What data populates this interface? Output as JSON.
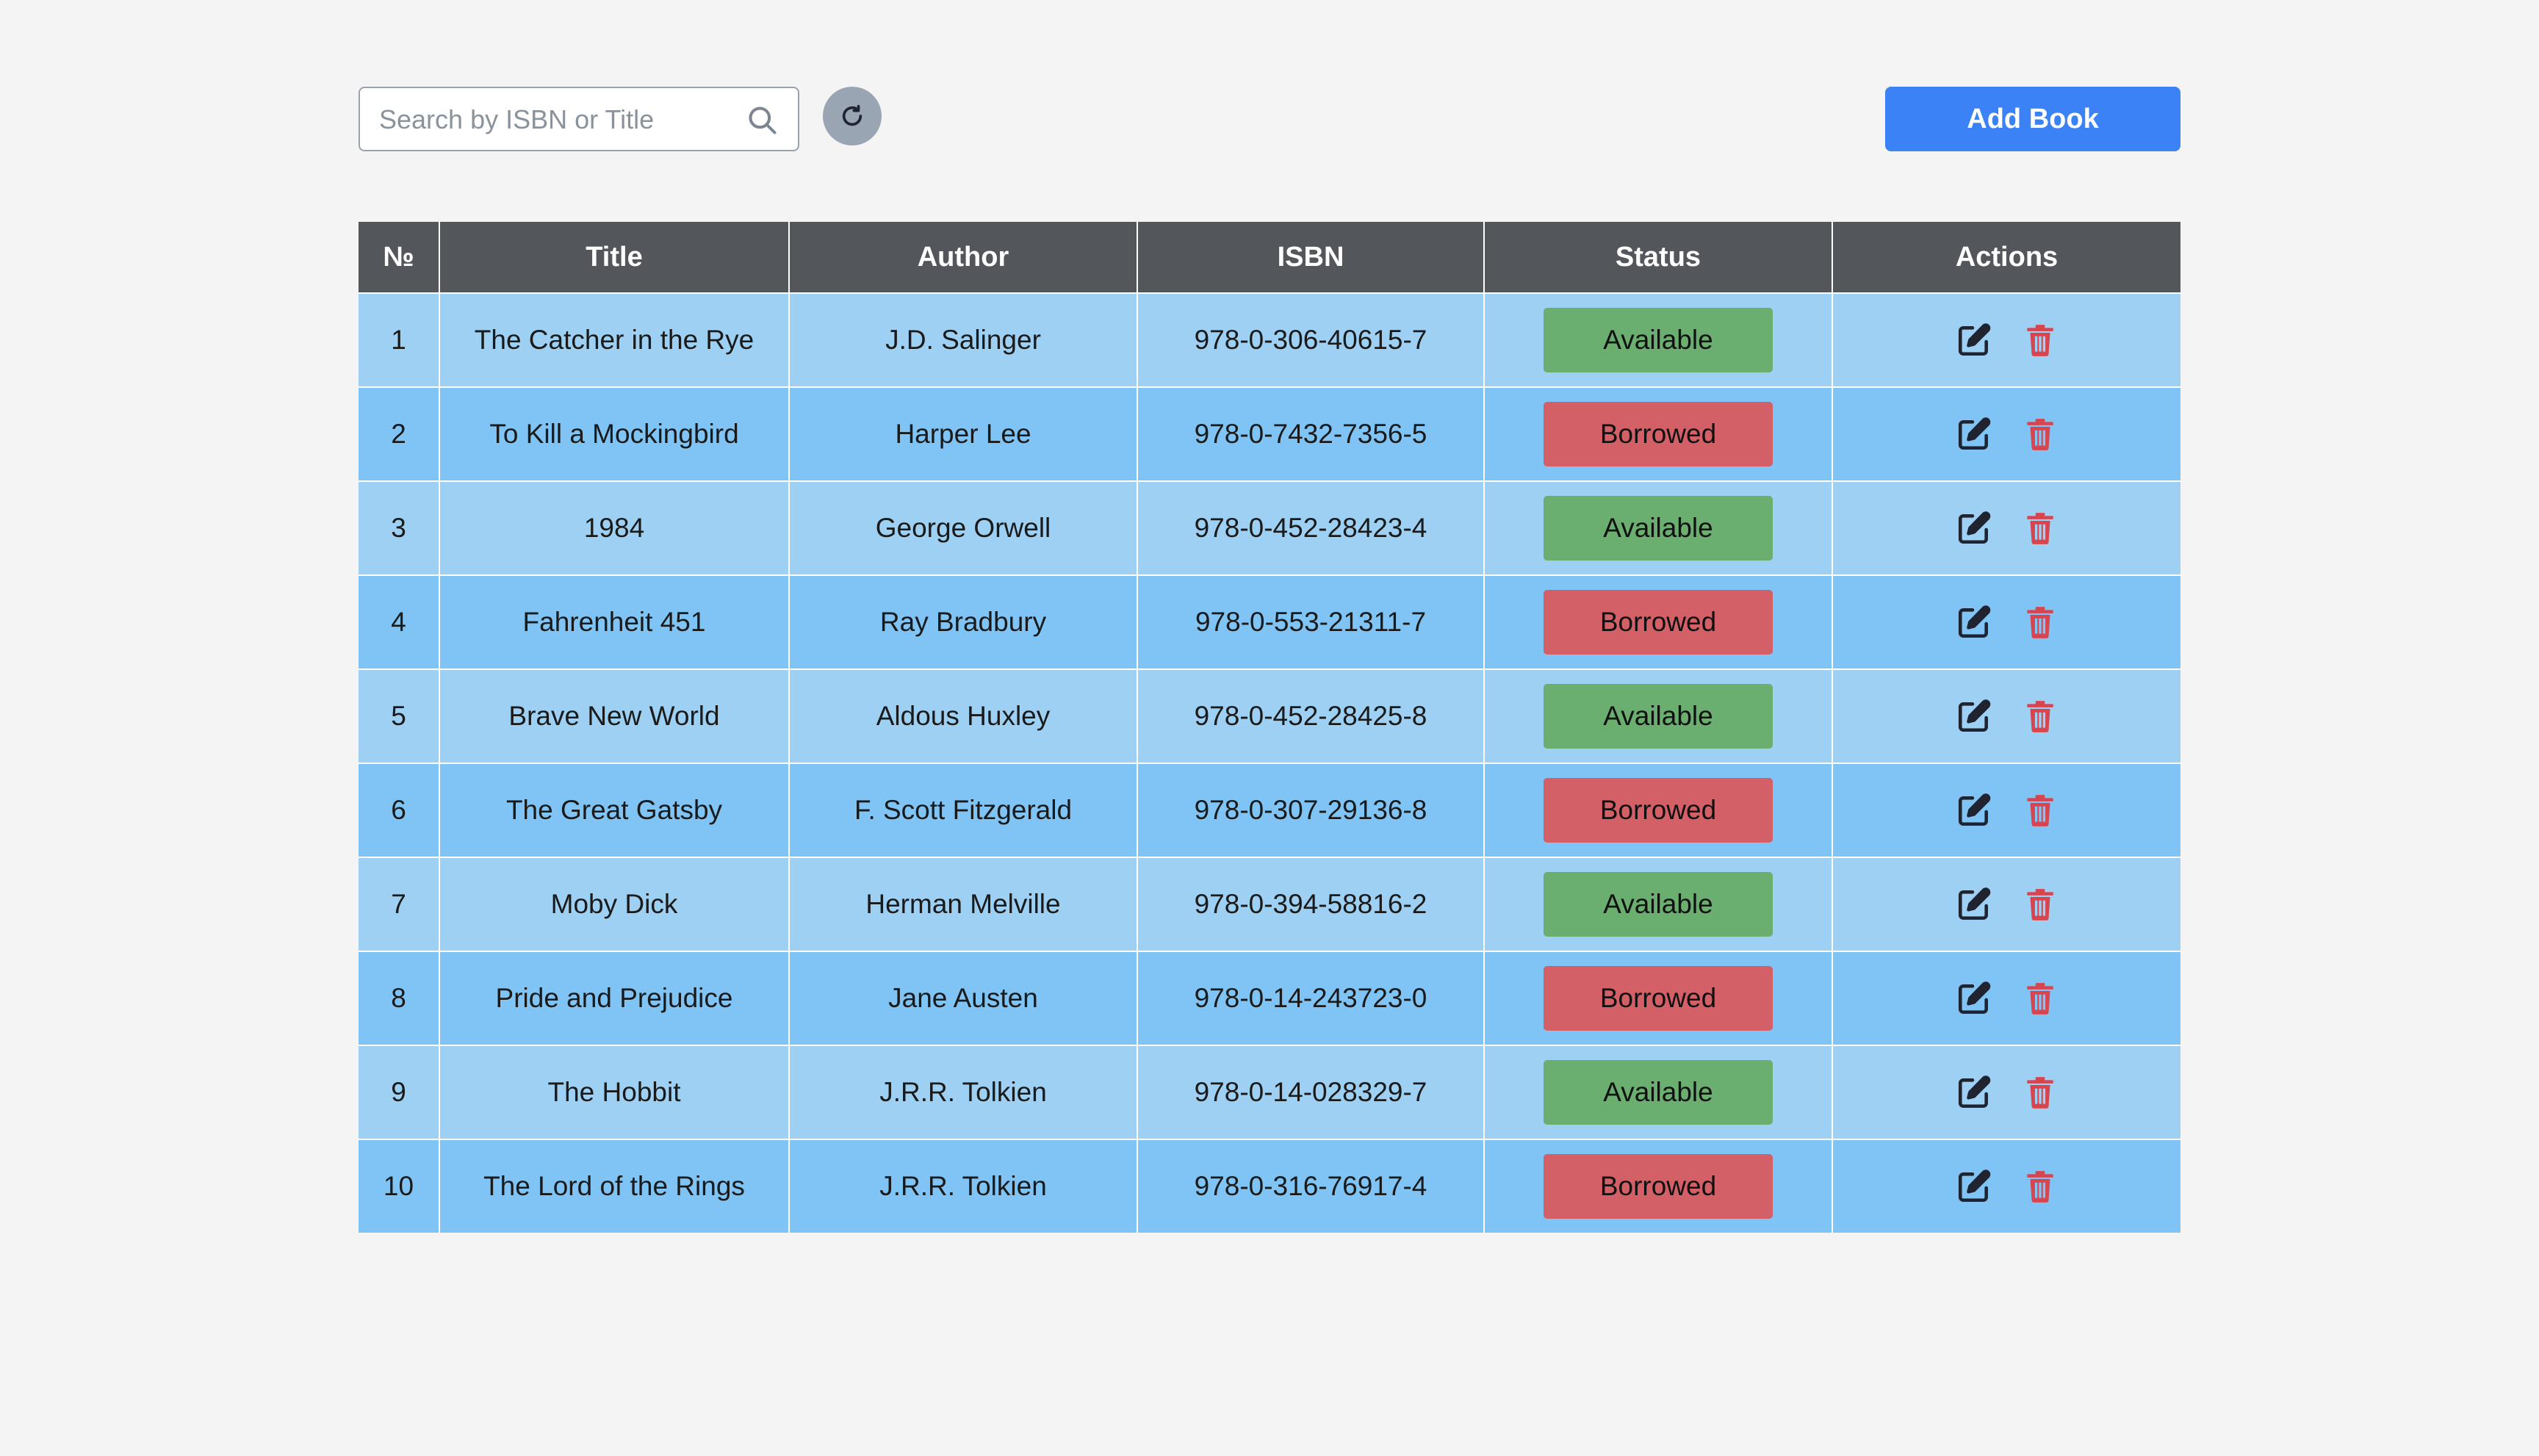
{
  "search": {
    "placeholder": "Search by ISBN or Title",
    "icon": "search-icon"
  },
  "toolbar": {
    "refresh_icon": "refresh-icon",
    "add_label": "Add Book"
  },
  "colors": {
    "header_bg": "#53575c",
    "row_odd": "#9dd0f2",
    "row_even": "#7fc4f4",
    "available": "#6aae70",
    "borrowed": "#d35f67",
    "primary": "#3b82f6",
    "delete_icon": "#d9454f"
  },
  "table": {
    "headers": [
      "№",
      "Title",
      "Author",
      "ISBN",
      "Status",
      "Actions"
    ],
    "rows": [
      {
        "no": "1",
        "title": "The Catcher in the Rye",
        "author": "J.D. Salinger",
        "isbn": "978-0-306-40615-7",
        "status": "Available"
      },
      {
        "no": "2",
        "title": "To Kill a Mockingbird",
        "author": "Harper Lee",
        "isbn": "978-0-7432-7356-5",
        "status": "Borrowed"
      },
      {
        "no": "3",
        "title": "1984",
        "author": "George Orwell",
        "isbn": "978-0-452-28423-4",
        "status": "Available"
      },
      {
        "no": "4",
        "title": "Fahrenheit 451",
        "author": "Ray Bradbury",
        "isbn": "978-0-553-21311-7",
        "status": "Borrowed"
      },
      {
        "no": "5",
        "title": "Brave New World",
        "author": "Aldous Huxley",
        "isbn": "978-0-452-28425-8",
        "status": "Available"
      },
      {
        "no": "6",
        "title": "The Great Gatsby",
        "author": "F. Scott Fitzgerald",
        "isbn": "978-0-307-29136-8",
        "status": "Borrowed"
      },
      {
        "no": "7",
        "title": "Moby Dick",
        "author": "Herman Melville",
        "isbn": "978-0-394-58816-2",
        "status": "Available"
      },
      {
        "no": "8",
        "title": "Pride and Prejudice",
        "author": "Jane Austen",
        "isbn": "978-0-14-243723-0",
        "status": "Borrowed"
      },
      {
        "no": "9",
        "title": "The Hobbit",
        "author": "J.R.R. Tolkien",
        "isbn": "978-0-14-028329-7",
        "status": "Available"
      },
      {
        "no": "10",
        "title": "The Lord of the Rings",
        "author": "J.R.R. Tolkien",
        "isbn": "978-0-316-76917-4",
        "status": "Borrowed"
      }
    ],
    "action_icons": [
      "edit-icon",
      "trash-icon"
    ]
  }
}
